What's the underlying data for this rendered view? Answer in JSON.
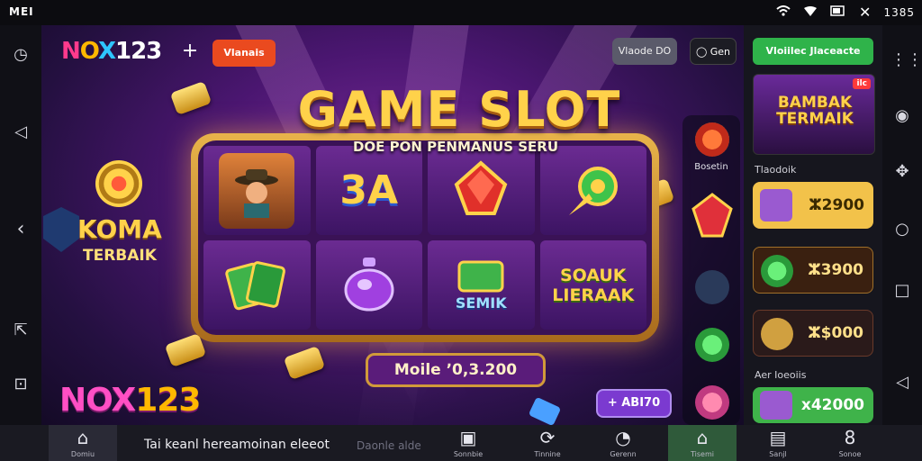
{
  "status_bar": {
    "left": "MEI",
    "time": "1385",
    "icons": [
      "wifi-icon",
      "signal-icon",
      "battery-icon",
      "close-icon"
    ]
  },
  "left_rail": [
    "clock-icon",
    "back-triangle-icon",
    "chevron-left-icon",
    "share-icon",
    "camera-icon"
  ],
  "right_rail": [
    "settings-icon",
    "chat-icon",
    "gamepad-icon",
    "home-circle-icon",
    "square-icon",
    "back-icon"
  ],
  "header": {
    "logo": {
      "n": "N",
      "o": "O",
      "x": "X",
      "digits": "123"
    },
    "plus_label": "+",
    "orange_button": "Vlanais",
    "gray_button": "Vlaode DO",
    "dark_button": "Gen"
  },
  "game": {
    "title": "GAME SLOT",
    "subtitle": "DOE PON PENMANUS SERU",
    "left_promo": {
      "line1": "KOMA",
      "line2": "TERBAIK"
    },
    "reel_texts": {
      "reel2": "3A",
      "reel7": "SEMIK",
      "reel8": "SOAUK LIERAAK"
    },
    "balance": "Moile ʼ0,3.200",
    "bottom_logo": {
      "main": "NOX",
      "tail": "123"
    },
    "add_button": "+ ABI70"
  },
  "mid_column": {
    "label": "Bosetin"
  },
  "panel": {
    "top_button": "Vloiilec Jlaceacte",
    "banner": {
      "line1": "BAMBAK",
      "line2": "TERMAIK",
      "tag": "ilc"
    },
    "section1_label": "Tlaodoik",
    "cards": [
      {
        "value": "ⵣ2900",
        "bg": "#f2c24a",
        "fg": "#3a2a00"
      },
      {
        "value": "ⵣ3900",
        "bg": "#3a2010",
        "fg": "#ffe08a"
      },
      {
        "value": "ⵣ$000",
        "bg": "#2a1a1a",
        "fg": "#ffe08a"
      }
    ],
    "section2_label": "Aer Ioeoiis",
    "bottom_card": {
      "value": "x42000",
      "bg": "#3fb34a",
      "fg": "#ffffff"
    }
  },
  "bottom_nav": {
    "ticker": "Tai keanl hereamoinan eleeot",
    "ticker_secondary": "Daonle alde",
    "items": [
      {
        "icon": "home-icon",
        "label": "Domiu"
      },
      {
        "icon": "inbox-icon",
        "label": "Sonnbie"
      },
      {
        "icon": "refresh-icon",
        "label": "Tinnine"
      },
      {
        "icon": "notification-icon",
        "label": "Gerenn"
      },
      {
        "icon": "store-icon",
        "label": "Tisemi"
      },
      {
        "icon": "gift-icon",
        "label": "Sanjl"
      },
      {
        "icon": "number-icon",
        "label": "Sonoe"
      }
    ]
  }
}
